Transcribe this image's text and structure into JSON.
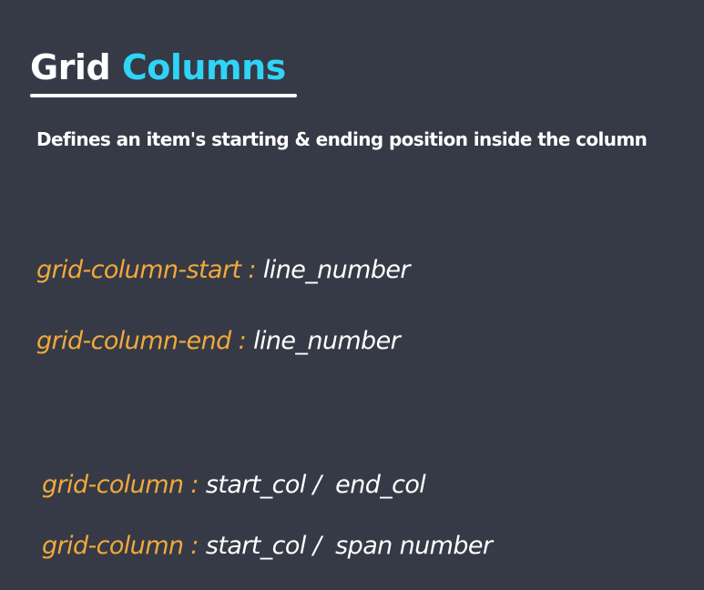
{
  "title": {
    "part1": "Grid",
    "part2": "Columns"
  },
  "subtitle": "Defines an item's starting & ending position inside the column",
  "colors": {
    "background": "#363a46",
    "title_accent": "#2fd4f7",
    "property": "#f2a93b",
    "value": "#ffffff"
  },
  "lines": [
    {
      "property": "grid-column-start :",
      "value": "line_number"
    },
    {
      "property": "grid-column-end :",
      "value": "line_number"
    },
    {
      "property": "grid-column :",
      "value": "start_col /  end_col"
    },
    {
      "property": "grid-column :",
      "value": "start_col /  span number"
    }
  ]
}
